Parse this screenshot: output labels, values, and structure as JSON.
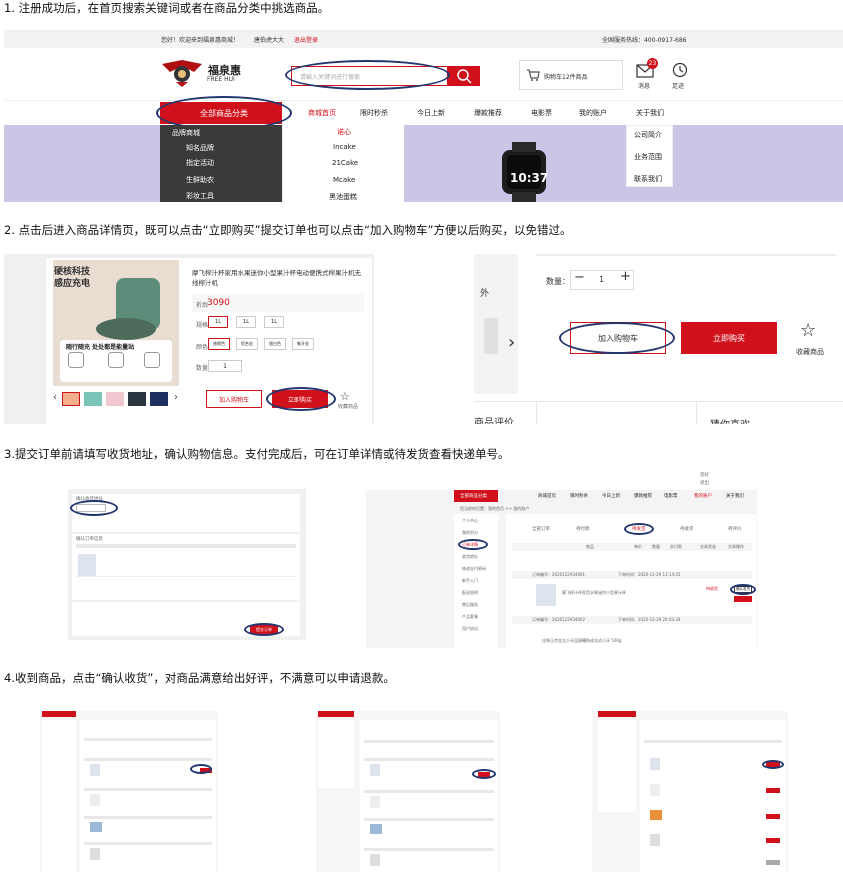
{
  "steps": {
    "s1": "1. 注册成功后，在首页搜索关键词或者在商品分类中挑选商品。",
    "s2": "2. 点击后进入商品详情页，既可以点击“立即购买”提交订单也可以点击“加入购物车”方便以后购买，以免错过。",
    "s3": "3.提交订单前请填写收货地址，确认购物信息。支付完成后，可在订单详情或待发货查看快递单号。",
    "s4": "4.收到商品，点击“确认收货”，对商品满意给出好评，不满意可以申请退款。"
  },
  "home": {
    "welcome": "您好！欢迎来到福泉惠商城！",
    "username": "唐伯虎大大",
    "logout": "退出登录",
    "hotline": "全国服务热线：400-0917-686",
    "logo_cn": "福泉惠",
    "logo_en": "FREE HUI",
    "search_placeholder": "请输入关键词进行搜索",
    "cart": "购物车12件商品",
    "msg_badge": "23",
    "msg": "消息",
    "footprint": "足迹",
    "all_category": "全部商品分类",
    "nav": [
      "商城首页",
      "限时秒杀",
      "今日上新",
      "爆款推荐",
      "电影票",
      "我的账户",
      "关于我们"
    ],
    "cats": [
      "品牌商城",
      "知名品牌",
      "指定活动",
      "生鲜助农",
      "彩妆工具"
    ],
    "sub": [
      "诺心",
      "Incake",
      "21Cake",
      "Mcake",
      "黑池蛋糕"
    ],
    "about": [
      "公司简介",
      "业务范围",
      "联系我们"
    ],
    "watch_time": "10:37"
  },
  "detail": {
    "promo1": "硬核科技",
    "promo2": "感应充电",
    "promo3": "随行随充 处处都是能量站",
    "title": "摩飞榨汁杯家用水果迷你小型果汁杯电动便携式榨果汁机无线榨汁机",
    "price_label": "折后",
    "price": "3090",
    "spec_label": "规格",
    "color_label": "颜色",
    "qty_label": "数量",
    "qty_value": "1",
    "add_cart": "加入购物车",
    "buy_now": "立即购买",
    "favorite": "收藏商品",
    "spec_opts": [
      "1L",
      "1L",
      "1L"
    ],
    "color_opts": [
      "香槟色",
      "铝合金",
      "银白色",
      "象牙金"
    ],
    "zoom_qty_label": "数量：",
    "zoom_qty_value": "1",
    "zoom_add": "加入购物车",
    "zoom_buy": "立即购买",
    "zoom_fav": "收藏商品",
    "review": "商品评价",
    "guess": "猜你喜欢",
    "outside": "外",
    "qty_minus": "−",
    "qty_plus": "+"
  },
  "order": {
    "left_header": "确认收货地址",
    "left_sub": "确认订单信息",
    "submit": "提交订单",
    "breadcrumb": "您当前的位置：我的首页 >> 我的账户",
    "tabs": [
      "全部订单",
      "待付款",
      "待发货",
      "待收货",
      "待评价"
    ],
    "cols": [
      "商品",
      "单价",
      "数量",
      "实付款",
      "交易状态",
      "交易操作"
    ],
    "order_no_1": "订单编号：2020122934001",
    "time_1": "下单时间：2020-12-29 13:14:25",
    "order_no_2": "订单编号：2020122934002",
    "time_2": "下单时间：2020-12-29 20:03:34",
    "menu": [
      "个人中心",
      "我的积分",
      "订单详情",
      "收货地址",
      "修改支付密码",
      "新手入门",
      "配送说明",
      "售后服务",
      "产品套餐",
      "用户协议"
    ],
    "prod_1": "摩飞榨汁杯家用水果迷你小型果汁杯",
    "prod_2": "庄典正宗金太小牙蕊醇糟熟成法式小牙 500g",
    "status_1": "待收货",
    "action_1": "确认收货",
    "top_right": "您好",
    "top_right_2": "退出",
    "all_cat": "全部商品分类",
    "nav": [
      "商城首页",
      "限时秒杀",
      "今日上新",
      "爆款推荐",
      "电影票",
      "我的账户",
      "关于我们"
    ]
  }
}
